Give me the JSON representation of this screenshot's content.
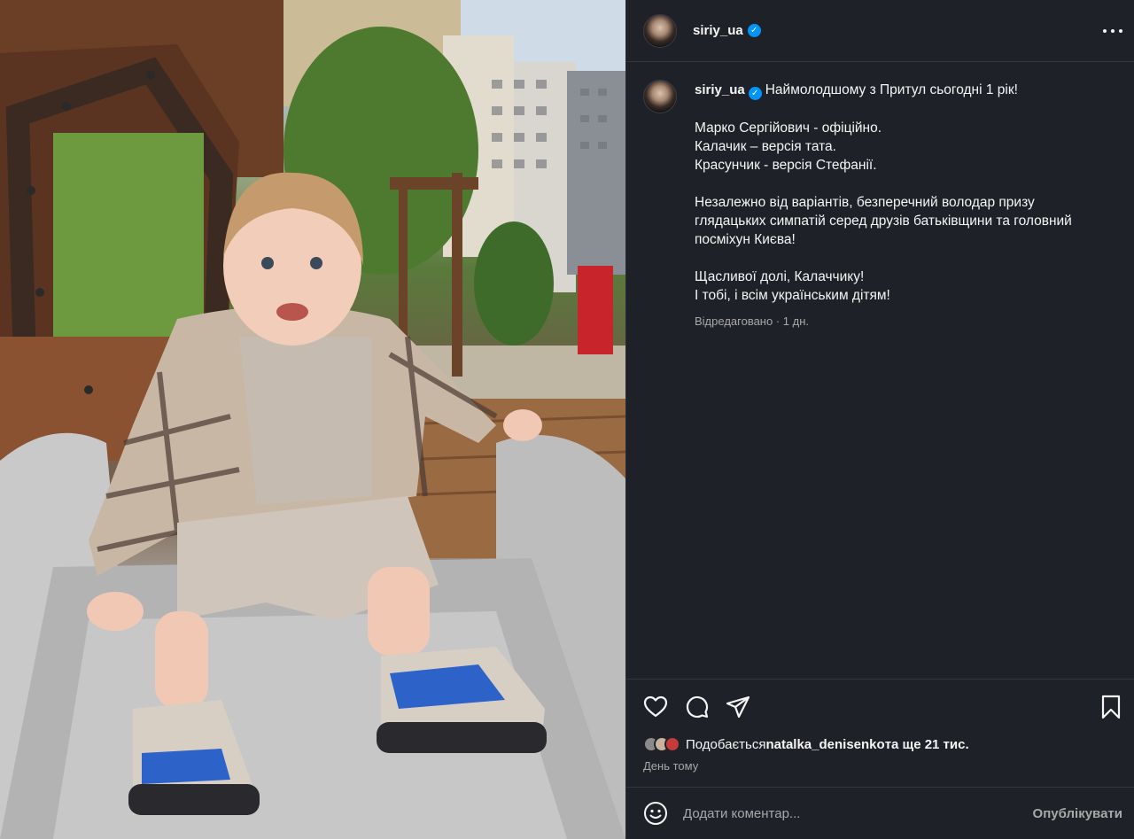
{
  "post": {
    "username": "siriy_ua",
    "verified_mark": "✓",
    "more_label": "more-options"
  },
  "caption": {
    "first_line": "Наймолодшому з Притул сьогодні 1 рік!",
    "lines_block1": [
      "Марко Сергійович - офіційно.",
      "Калачик – версія тата.",
      "Красунчик - версія Стефанії."
    ],
    "block2": "Незалежно від варіантів, безперечний володар призу глядацьких симпатій серед друзів батьківщини та головний посміхун Києва!",
    "lines_block3": [
      "Щасливої долі, Калаччику!",
      "І тобі, і всім українським дітям!"
    ],
    "edited": "Відредаговано",
    "age": "· 1 дн."
  },
  "actions": {
    "icons": [
      "heart-icon",
      "comment-icon",
      "share-icon",
      "bookmark-icon"
    ]
  },
  "likes": {
    "prefix": "Подобається",
    "user": "natalka_denisenko",
    "suffix": "та ще 21 тис."
  },
  "timestamp": "День тому",
  "comment": {
    "placeholder": "Додати коментар...",
    "publish_label": "Опублікувати"
  },
  "colors": {
    "panel_bg": "#1f2128",
    "verified": "#0095f6",
    "muted_text": "#a8a8a8"
  }
}
